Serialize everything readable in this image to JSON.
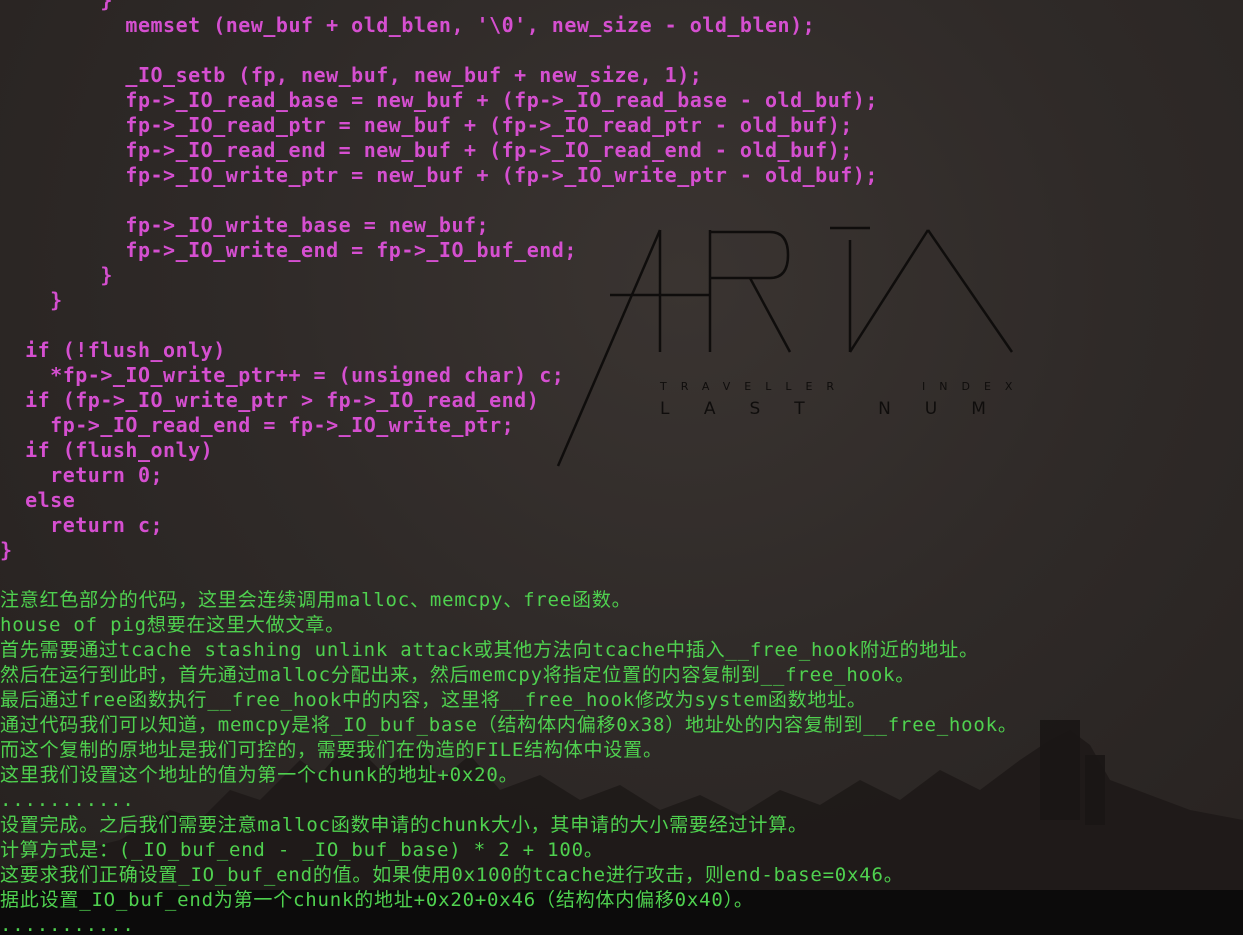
{
  "code_lines": [
    "        }",
    "          memset (new_buf + old_blen, '\\0', new_size - old_blen);",
    "",
    "          _IO_setb (fp, new_buf, new_buf + new_size, 1);",
    "          fp->_IO_read_base = new_buf + (fp->_IO_read_base - old_buf);",
    "          fp->_IO_read_ptr = new_buf + (fp->_IO_read_ptr - old_buf);",
    "          fp->_IO_read_end = new_buf + (fp->_IO_read_end - old_buf);",
    "          fp->_IO_write_ptr = new_buf + (fp->_IO_write_ptr - old_buf);",
    "",
    "          fp->_IO_write_base = new_buf;",
    "          fp->_IO_write_end = fp->_IO_buf_end;",
    "        }",
    "    }",
    "",
    "  if (!flush_only)",
    "    *fp->_IO_write_ptr++ = (unsigned char) c;",
    "  if (fp->_IO_write_ptr > fp->_IO_read_end)",
    "    fp->_IO_read_end = fp->_IO_write_ptr;",
    "  if (flush_only)",
    "    return 0;",
    "  else",
    "    return c;",
    "}"
  ],
  "notes": [
    "",
    "注意红色部分的代码，这里会连续调用malloc、memcpy、free函数。",
    "house of pig想要在这里大做文章。",
    "首先需要通过tcache stashing unlink attack或其他方法向tcache中插入__free_hook附近的地址。",
    "然后在运行到此时，首先通过malloc分配出来，然后memcpy将指定位置的内容复制到__free_hook。",
    "最后通过free函数执行__free_hook中的内容，这里将__free_hook修改为system函数地址。",
    "通过代码我们可以知道，memcpy是将_IO_buf_base（结构体内偏移0x38）地址处的内容复制到__free_hook。",
    "而这个复制的原地址是我们可控的，需要我们在伪造的FILE结构体中设置。",
    "这里我们设置这个地址的值为第一个chunk的地址+0x20。",
    "...........",
    "设置完成。之后我们需要注意malloc函数申请的chunk大小，其申请的大小需要经过计算。",
    "计算方式是：(_IO_buf_end - _IO_buf_base) * 2 + 100。",
    "这要求我们正确设置_IO_buf_end的值。如果使用0x100的tcache进行攻击，则end-base=0x46。",
    "据此设置_IO_buf_end为第一个chunk的地址+0x20+0x46（结构体内偏移0x40）。",
    "..........."
  ],
  "logo": {
    "title": "ARIA",
    "subtitle_left": "TRAVELLER",
    "subtitle_right": "INDEX",
    "tagline": "LAST NUMBER"
  },
  "colors": {
    "code": "#d54fd0",
    "note": "#4fd14f",
    "background": "#2e2927"
  }
}
